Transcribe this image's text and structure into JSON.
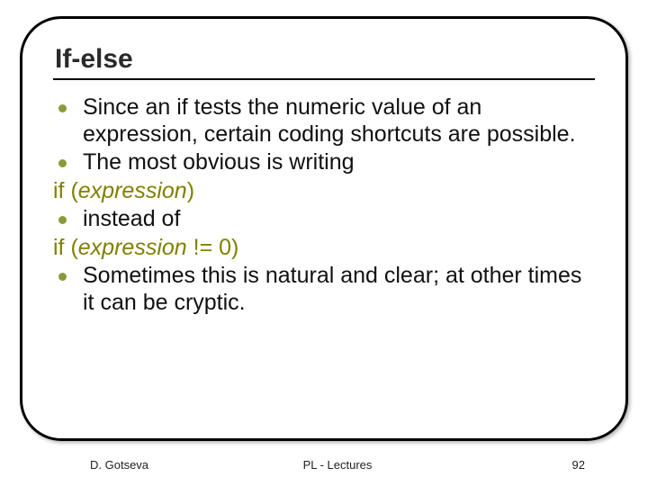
{
  "title": "If-else",
  "bullets": {
    "b1": "Since an if tests the numeric value of an expression, certain coding shortcuts are possible.",
    "b2": "The most obvious is writing",
    "b3": "instead of",
    "b4": "Sometimes this is natural and clear; at other times it can be cryptic."
  },
  "lines": {
    "l1_a": "if (",
    "l1_b": "expression",
    "l1_c": ")",
    "l2_a": "if (",
    "l2_b": "expression",
    "l2_c": " != 0)"
  },
  "footer": {
    "left": "D. Gotseva",
    "center": "PL - Lectures",
    "right": "92"
  }
}
